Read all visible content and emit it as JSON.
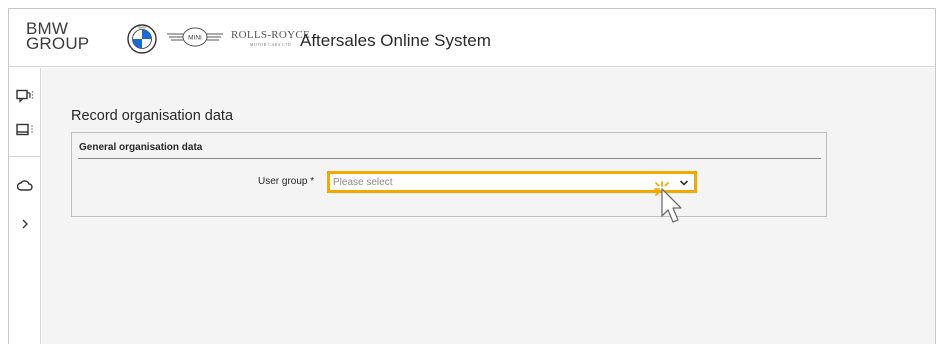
{
  "header": {
    "brand_line1": "BMW",
    "brand_line2": "GROUP",
    "rolls_royce_text": "ROLLS-ROYCE",
    "rolls_royce_sub": "MOTOR CARS LTD",
    "mini_text": "MINI",
    "app_title": "Aftersales Online System"
  },
  "sidebar": {
    "items": [
      {
        "icon": "chat-icon"
      },
      {
        "icon": "monitor-icon"
      },
      {
        "icon": "cloud-icon"
      },
      {
        "icon": "chevron-right-icon"
      }
    ]
  },
  "main": {
    "page_title": "Record organisation data",
    "section_title": "General organisation data",
    "user_group_label": "User group *",
    "user_group_value": "Please select"
  },
  "colors": {
    "highlight": "#f5a800",
    "content_bg": "#f4f4f4"
  }
}
